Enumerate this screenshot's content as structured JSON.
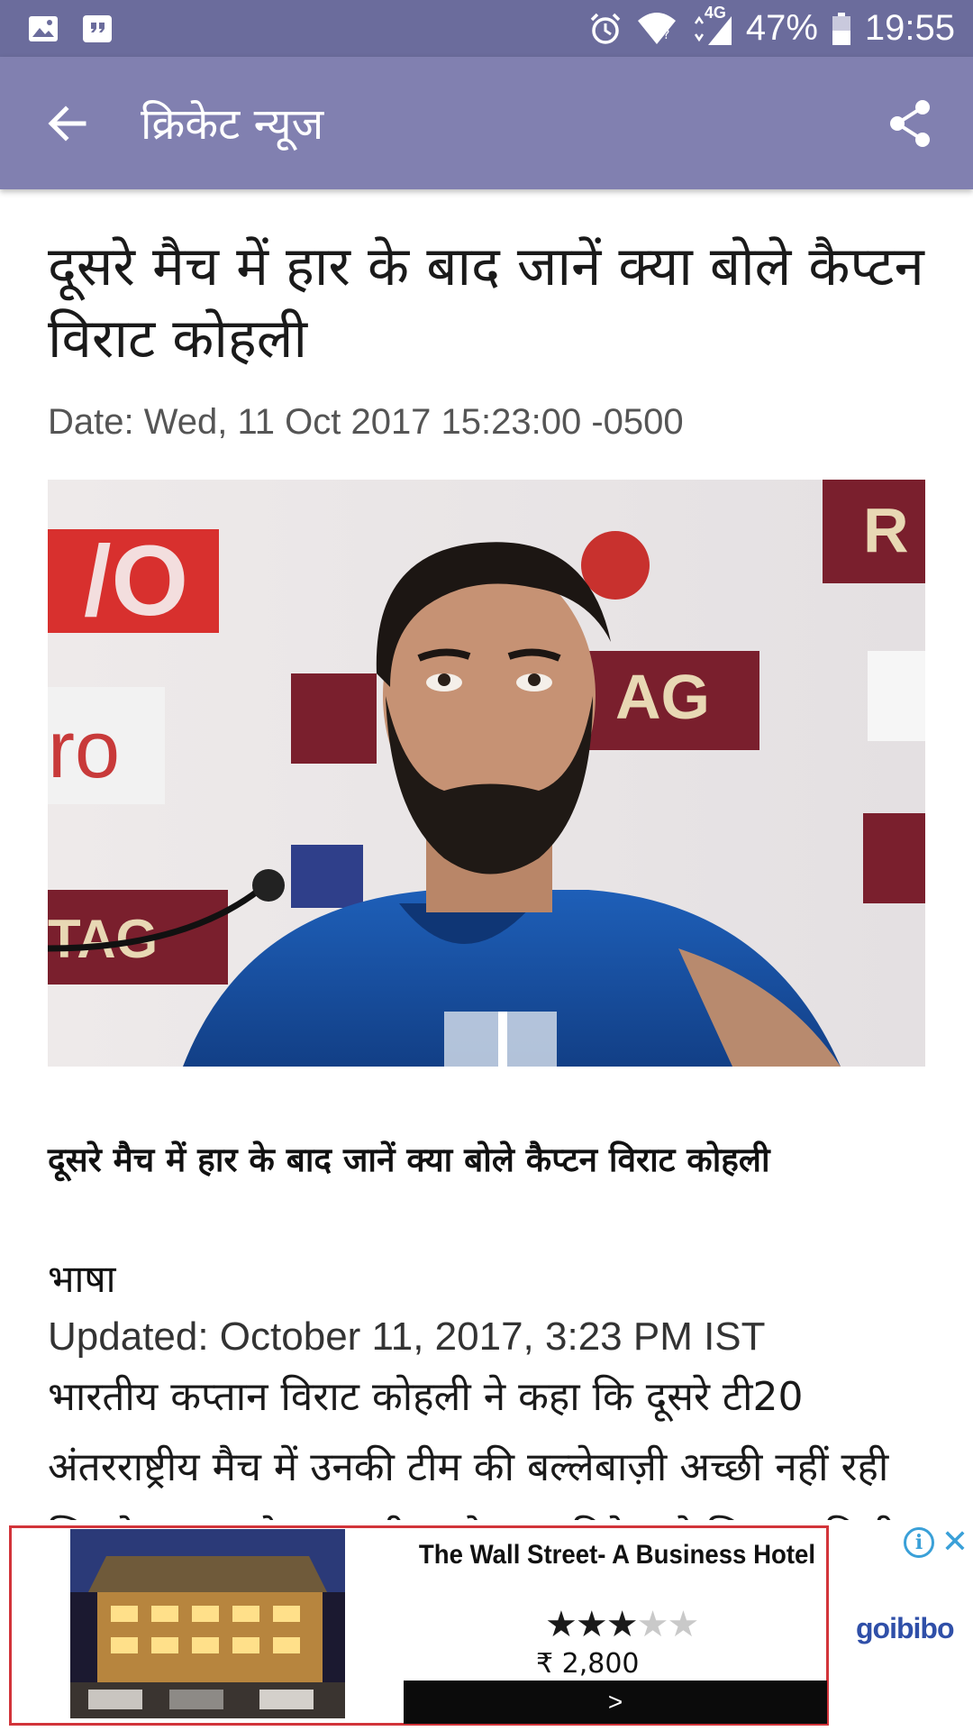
{
  "status_bar": {
    "network": "4G",
    "battery": "47%",
    "time": "19:55"
  },
  "app_bar": {
    "title": "क्रिकेट न्यूज"
  },
  "article": {
    "headline": "दूसरे मैच में हार के बाद जानें क्या बोले कैप्टन विराट कोहली",
    "date": "Date: Wed, 11 Oct 2017 15:23:00 -0500",
    "subhead": "दूसरे मैच में हार के बाद जानें क्या बोले कैप्टन विराट कोहली",
    "byline": "भाषा",
    "updated": "Updated: October 11, 2017, 3:23 PM IST",
    "body": "भारतीय कप्तान विराट कोहली ने कहा कि दूसरे टी20 अंतरराष्ट्रीय मैच में उनकी टीम की बल्लेबाज़ी अच्छी नहीं रही जिसके कारण मेजबान टीम को आठ विकेट से शिकस्त मिली"
  },
  "ad": {
    "hotel_name": "The Wall Street- A Business Hotel",
    "rating": 3,
    "rating_max": 5,
    "price": "₹ 2,800",
    "cta": ">",
    "brand": "goibibo"
  },
  "icons": {
    "back": "arrow-left-icon",
    "share": "share-icon"
  },
  "colors": {
    "status_bar": "#6b6c9c",
    "app_bar": "#8180b0",
    "ad_border": "#d2343a",
    "ad_accent": "#3aa0d8"
  }
}
